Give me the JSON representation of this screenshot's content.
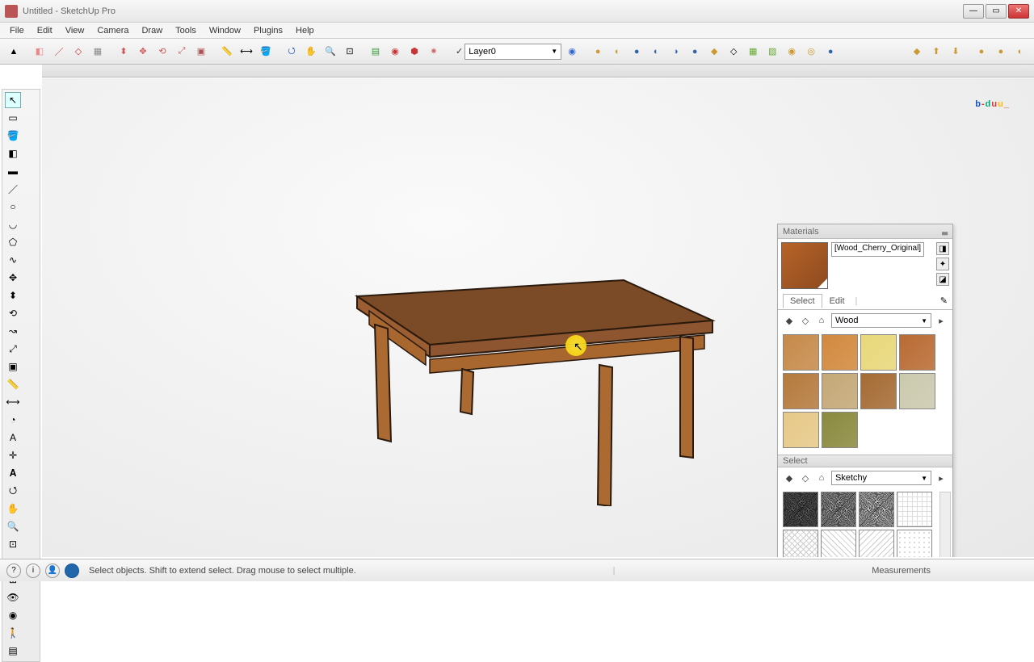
{
  "title": "Untitled - SketchUp Pro",
  "menu": [
    "File",
    "Edit",
    "View",
    "Camera",
    "Draw",
    "Tools",
    "Window",
    "Plugins",
    "Help"
  ],
  "layer": {
    "checked": true,
    "name": "Layer0"
  },
  "materials_panel": {
    "title": "Materials",
    "current_name": "[Wood_Cherry_Original]",
    "tabs": {
      "select": "Select",
      "edit": "Edit"
    },
    "library": "Wood",
    "styles_title": "Select",
    "styles_library": "Sketchy"
  },
  "wood_swatches": [
    "#c68a4a",
    "#d2893e",
    "#e8d87a",
    "#b96b33",
    "#b57a3d",
    "#c4a877",
    "#a56b34",
    "#cbc9ad",
    "#e6c988",
    "#8b8a3f"
  ],
  "sketchy_swatches": [
    {
      "bg": "#555",
      "pat": "noise"
    },
    {
      "bg": "#999",
      "pat": "noise"
    },
    {
      "bg": "#bbb",
      "pat": "noise"
    },
    {
      "bg": "#fff",
      "pat": "grid"
    },
    {
      "bg": "#fff",
      "pat": "cross"
    },
    {
      "bg": "#fff",
      "pat": "diag"
    },
    {
      "bg": "#fff",
      "pat": "diag2"
    },
    {
      "bg": "#fff",
      "pat": "dots"
    }
  ],
  "status": {
    "hint": "Select objects. Shift to extend select. Drag mouse to select multiple.",
    "measure_label": "Measurements"
  },
  "logo": [
    "b",
    "-",
    "d",
    "u",
    "u",
    "_"
  ]
}
